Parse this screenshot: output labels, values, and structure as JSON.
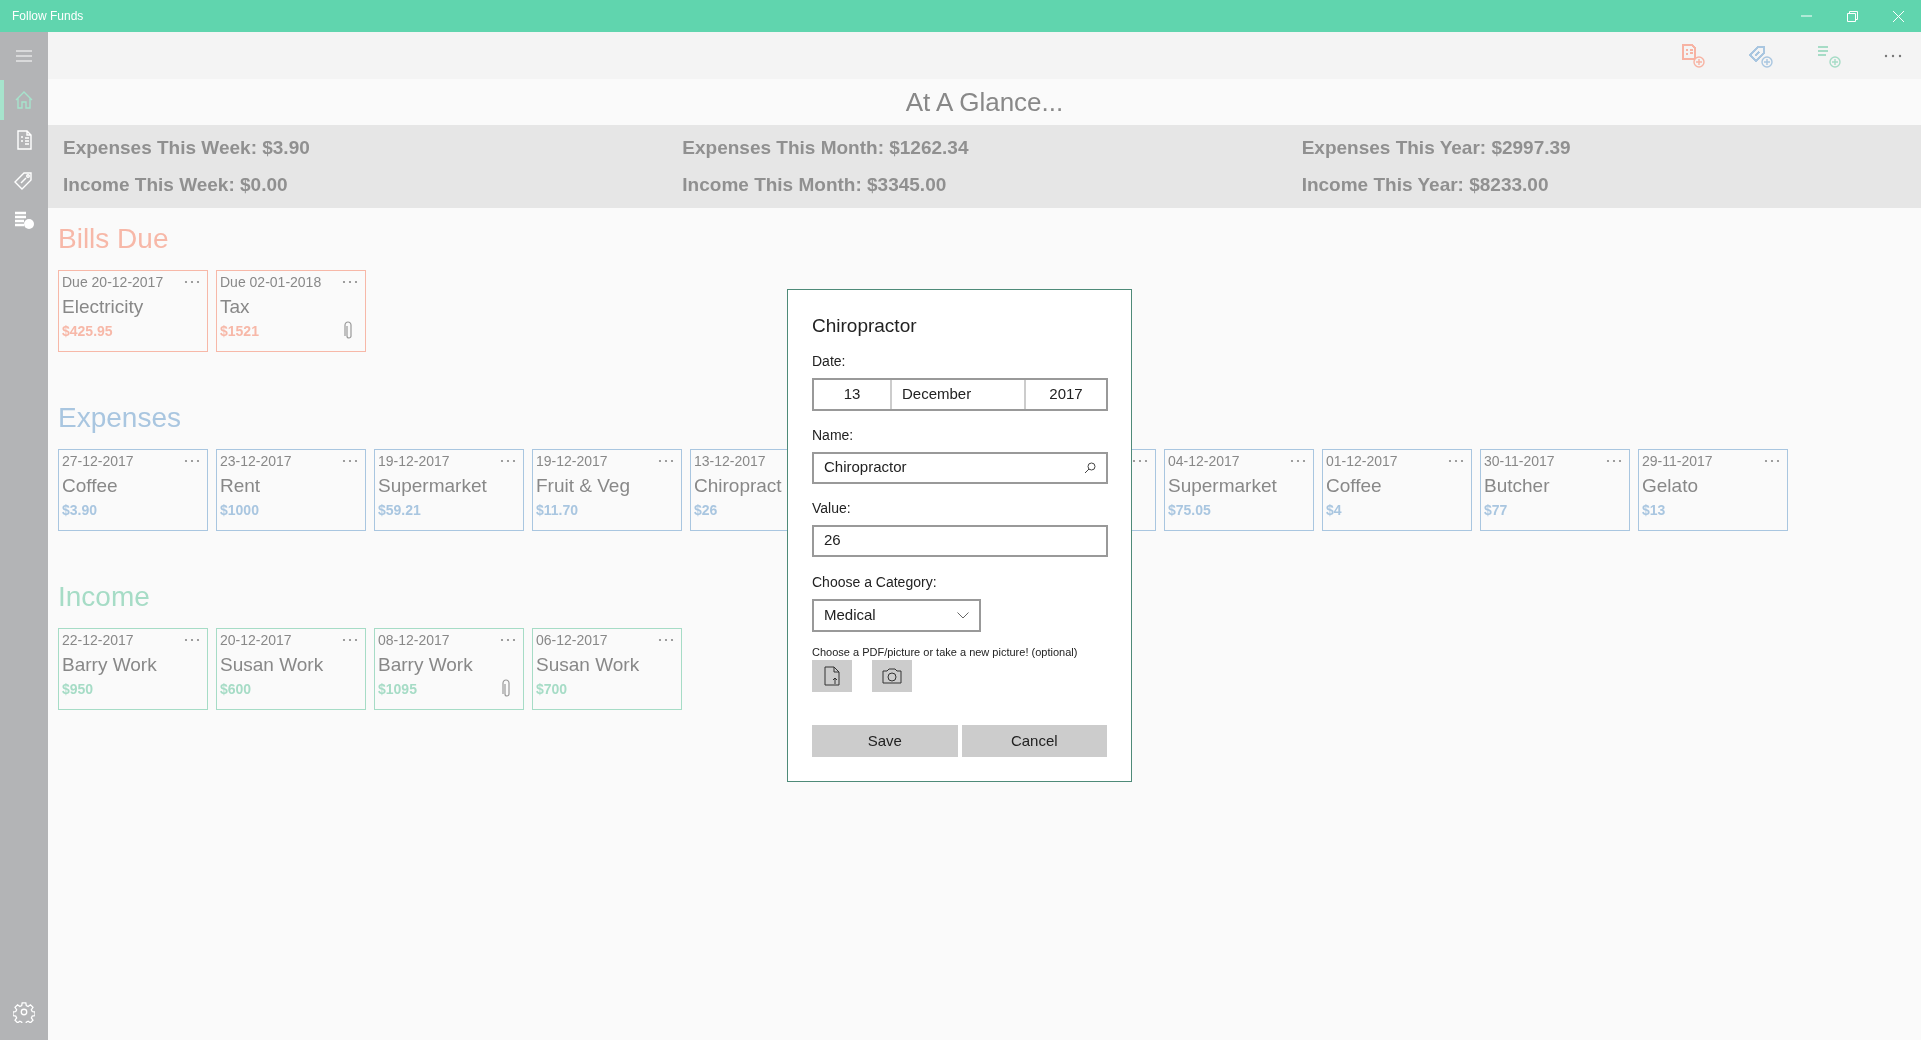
{
  "window": {
    "title": "Follow Funds"
  },
  "sidebar": {
    "items": [
      {
        "kind": "home",
        "selected": true
      },
      {
        "kind": "bills",
        "selected": false
      },
      {
        "kind": "expenses",
        "selected": false
      },
      {
        "kind": "income",
        "selected": false
      }
    ]
  },
  "toolbar": {
    "actions": [
      {
        "kind": "add-bill",
        "color": "#f7b3a3"
      },
      {
        "kind": "add-expense",
        "color": "#a9c6e0"
      },
      {
        "kind": "add-income",
        "color": "#a6dcc6"
      }
    ]
  },
  "heading": "At A Glance...",
  "stats": [
    [
      "Expenses This Week: $3.90",
      "Income This Week: $0.00"
    ],
    [
      "Expenses This Month: $1262.34",
      "Income This Month: $3345.00"
    ],
    [
      "Expenses This Year: $2997.39",
      "Income This Year: $8233.00"
    ]
  ],
  "sections": [
    {
      "title": "Bills Due",
      "color": "#f7b8a8",
      "cards": [
        {
          "date": "Due 20-12-2017",
          "name": "Electricity",
          "amount": "$425.95",
          "attachment": false
        },
        {
          "date": "Due 02-01-2018",
          "name": "Tax",
          "amount": "$1521",
          "attachment": true
        }
      ]
    },
    {
      "title": "Expenses",
      "color": "#a9c6e0",
      "cards": [
        {
          "date": "27-12-2017",
          "name": "Coffee",
          "amount": "$3.90",
          "attachment": false
        },
        {
          "date": "23-12-2017",
          "name": "Rent",
          "amount": "$1000",
          "attachment": false
        },
        {
          "date": "19-12-2017",
          "name": "Supermarket",
          "amount": "$59.21",
          "attachment": false
        },
        {
          "date": "19-12-2017",
          "name": "Fruit & Veg",
          "amount": "$11.70",
          "attachment": false
        },
        {
          "date": "13-12-2017",
          "name": "Chiropract",
          "amount": "$26"
        },
        {
          "kind": "covered"
        },
        {
          "date": "04-12-2017",
          "name": "Supermarket",
          "amount": "$75.05",
          "attachment": false
        },
        {
          "date": "01-12-2017",
          "name": "Coffee",
          "amount": "$4",
          "attachment": false
        },
        {
          "date": "30-11-2017",
          "name": "Butcher",
          "amount": "$77",
          "attachment": false
        },
        {
          "date": "29-11-2017",
          "name": "Gelato",
          "amount": "$13",
          "attachment": false
        }
      ]
    },
    {
      "title": "Income",
      "color": "#a6dcc6",
      "cards": [
        {
          "date": "22-12-2017",
          "name": "Barry Work",
          "amount": "$950",
          "attachment": false
        },
        {
          "date": "20-12-2017",
          "name": "Susan Work",
          "amount": "$600",
          "attachment": false
        },
        {
          "date": "08-12-2017",
          "name": "Barry Work",
          "amount": "$1095",
          "attachment": true
        },
        {
          "date": "06-12-2017",
          "name": "Susan Work",
          "amount": "$700",
          "attachment": false
        }
      ]
    }
  ],
  "dialog": {
    "title": "Chiropractor",
    "date_label": "Date:",
    "day": "13",
    "month": "December",
    "year": "2017",
    "name_label": "Name:",
    "name": "Chiropractor",
    "value_label": "Value:",
    "value": "26",
    "category_label": "Choose a Category:",
    "category": "Medical",
    "attach_hint": "Choose a PDF/picture or take a new picture! (optional)",
    "buttons": [
      "Save",
      "Cancel"
    ]
  }
}
